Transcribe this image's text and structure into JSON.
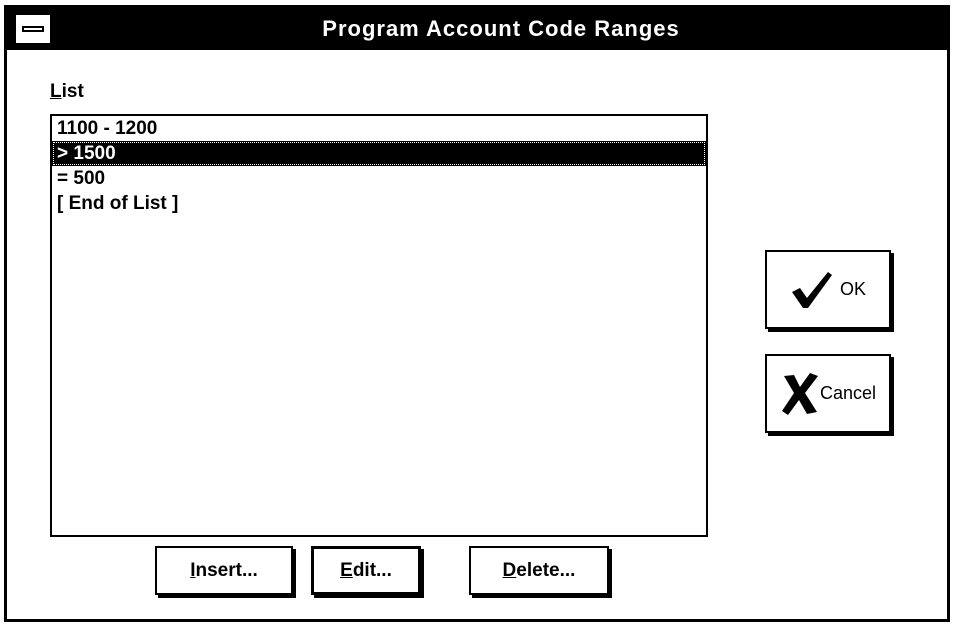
{
  "window": {
    "title": "Program Account Code Ranges"
  },
  "list": {
    "label_accel": "L",
    "label_rest": "ist",
    "items": [
      {
        "text": "1100 - 1200",
        "selected": false
      },
      {
        "text": "> 1500",
        "selected": true
      },
      {
        "text": "= 500",
        "selected": false
      },
      {
        "text": "[ End of List ]",
        "selected": false
      }
    ]
  },
  "buttons": {
    "insert": {
      "accel": "I",
      "rest": "nsert..."
    },
    "edit": {
      "accel": "E",
      "rest": "dit..."
    },
    "delete": {
      "accel": "D",
      "rest": "elete..."
    },
    "ok": {
      "label": "OK",
      "icon": "checkmark-icon"
    },
    "cancel": {
      "label": "Cancel",
      "icon": "x-cross-icon"
    }
  }
}
